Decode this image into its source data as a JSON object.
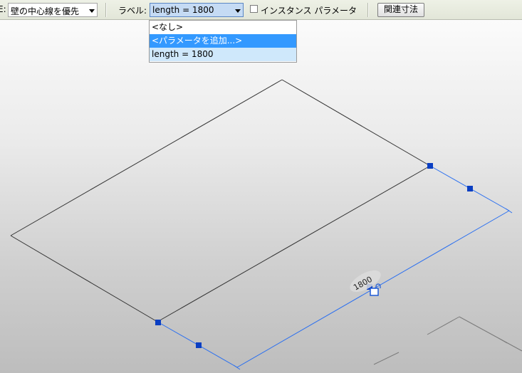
{
  "toolbar": {
    "location_prefix": "E:",
    "location_value": "壁の中心線を優先",
    "label_caption": "ラベル:",
    "label_value": "length = 1800",
    "instance_param_label": "インスタンス パラメータ",
    "related_dims_button": "関連寸法"
  },
  "dropdown": {
    "options": [
      "<なし>",
      "<パラメータを追加...>",
      "length = 1800"
    ],
    "highlighted_index": 1
  },
  "drawing": {
    "dimension_text": "1800",
    "dimension_color": "#2a6ff0",
    "grip_color": "#0a3ec2"
  }
}
